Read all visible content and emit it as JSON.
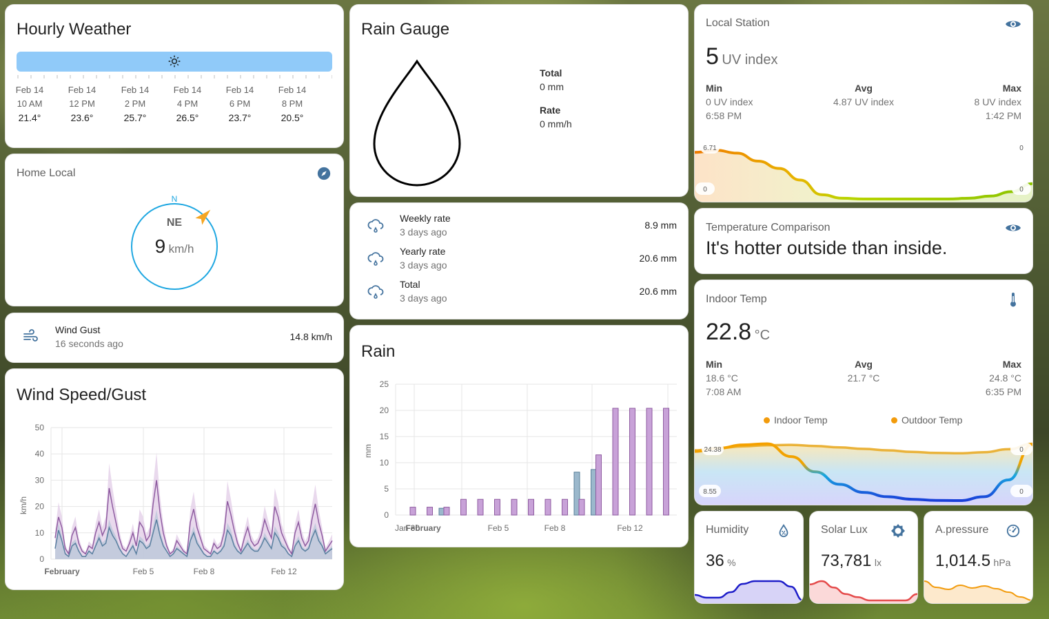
{
  "hourly_weather": {
    "title": "Hourly Weather",
    "forecast": [
      {
        "date": "Feb 14",
        "time": "10 AM",
        "temp": "21.4°"
      },
      {
        "date": "Feb 14",
        "time": "12 PM",
        "temp": "23.6°"
      },
      {
        "date": "Feb 14",
        "time": "2 PM",
        "temp": "25.7°"
      },
      {
        "date": "Feb 14",
        "time": "4 PM",
        "temp": "26.5°"
      },
      {
        "date": "Feb 14",
        "time": "6 PM",
        "temp": "23.7°"
      },
      {
        "date": "Feb 14",
        "time": "8 PM",
        "temp": "20.5°"
      }
    ],
    "bar_color": "#90caf9"
  },
  "home_local": {
    "title": "Home Local",
    "north": "N",
    "direction": "NE",
    "speed": "9",
    "unit": "km/h",
    "ring_color": "#1ea7e1",
    "arrow_color": "#f5a623"
  },
  "wind_gust": {
    "name": "Wind Gust",
    "ago": "16 seconds ago",
    "value": "14.8 km/h"
  },
  "wind_speed_gust": {
    "title": "Wind Speed/Gust",
    "ylabel": "km/h",
    "y_ticks": [
      "50",
      "40",
      "30",
      "20",
      "10",
      "0"
    ],
    "x_ticks": [
      "February",
      "Feb 5",
      "Feb 8",
      "Feb 12"
    ]
  },
  "rain_gauge": {
    "title": "Rain Gauge",
    "total_label": "Total",
    "total_value": "0 mm",
    "rate_label": "Rate",
    "rate_value": "0 mm/h"
  },
  "rain_rates": [
    {
      "name": "Weekly rate",
      "ago": "3 days ago",
      "value": "8.9 mm"
    },
    {
      "name": "Yearly rate",
      "ago": "3 days ago",
      "value": "20.6 mm"
    },
    {
      "name": "Total",
      "ago": "3 days ago",
      "value": "20.6 mm"
    }
  ],
  "rain_chart": {
    "title": "Rain",
    "ylabel": "mm",
    "y_ticks": [
      "25",
      "20",
      "15",
      "10",
      "5",
      "0"
    ],
    "x_ticks": [
      "Jan 30",
      "February",
      "Feb 5",
      "Feb 8",
      "Feb 12"
    ]
  },
  "chart_data": [
    {
      "type": "line",
      "title": "Wind Speed/Gust",
      "ylabel": "km/h",
      "ylim": [
        0,
        50
      ],
      "x_ticks": [
        "February",
        "Feb 5",
        "Feb 8",
        "Feb 12"
      ],
      "series": [
        {
          "values": [
            8,
            16,
            12,
            4,
            2,
            9,
            12,
            6,
            3,
            2,
            5,
            4,
            10,
            14,
            9,
            12,
            27,
            20,
            14,
            8,
            4,
            3,
            6,
            10,
            5,
            14,
            12,
            7,
            9,
            21,
            30,
            18,
            10,
            5,
            2,
            3,
            7,
            5,
            3,
            2,
            14,
            19,
            12,
            8,
            4,
            3,
            2,
            6,
            4,
            5,
            10,
            22,
            17,
            11,
            6,
            3,
            8,
            12,
            7,
            5,
            6,
            9,
            15,
            11,
            8,
            20,
            16,
            10,
            7,
            4,
            2,
            10,
            14,
            8,
            5,
            7,
            15,
            21,
            14,
            9,
            3,
            5,
            7
          ]
        },
        {
          "values": [
            4,
            11,
            7,
            2,
            1,
            5,
            6,
            3,
            1,
            1,
            3,
            2,
            5,
            8,
            5,
            6,
            12,
            9,
            7,
            4,
            2,
            1,
            3,
            5,
            2,
            7,
            6,
            4,
            5,
            10,
            15,
            9,
            5,
            3,
            1,
            2,
            4,
            3,
            2,
            1,
            7,
            10,
            6,
            4,
            2,
            1,
            1,
            3,
            2,
            3,
            5,
            11,
            9,
            5,
            3,
            2,
            4,
            6,
            4,
            3,
            3,
            5,
            8,
            6,
            4,
            10,
            8,
            5,
            4,
            2,
            1,
            5,
            7,
            4,
            3,
            4,
            8,
            11,
            7,
            5,
            2,
            3,
            4
          ]
        }
      ]
    },
    {
      "type": "bar",
      "title": "Rain",
      "ylabel": "mm",
      "ylim": [
        0,
        25
      ],
      "x_ticks": [
        "Jan 30",
        "February",
        "Feb 5",
        "Feb 8",
        "Feb 12"
      ],
      "series": [
        {
          "values": [
            1.5,
            1.5,
            1.5,
            3.0,
            3.0,
            3.0,
            3.0,
            3.0,
            3.0,
            3.0,
            3.0,
            11.5,
            20.4,
            20.4,
            20.4,
            20.4
          ]
        },
        {
          "values": [
            0,
            0,
            1.3,
            0,
            0,
            0,
            0,
            0,
            0,
            0,
            8.2,
            8.7,
            0,
            0,
            0,
            0
          ]
        }
      ]
    },
    {
      "type": "area",
      "title": "Local Station",
      "labels": [
        "6.71",
        "0",
        "0",
        "0"
      ],
      "series": [
        {
          "values": [
            6.4,
            6.71,
            6.3,
            5.2,
            4.2,
            2.6,
            0.6,
            0.1,
            0,
            0,
            0,
            0,
            0,
            0.1,
            0.4,
            1.0,
            2.1
          ]
        }
      ]
    },
    {
      "type": "line",
      "title": "Indoor Temp",
      "labels": [
        "24.38",
        "8.55",
        "0",
        "0"
      ],
      "series": [
        {
          "name": "Indoor Temp",
          "values": [
            22.3,
            22.9,
            23.4,
            23.7,
            23.8,
            23.5,
            23.1,
            22.7,
            22.3,
            21.9,
            21.6,
            21.5,
            21.8,
            22.6,
            24.1
          ]
        },
        {
          "name": "Outdoor Temp",
          "values": [
            22.0,
            22.9,
            23.8,
            24.1,
            20.6,
            16.4,
            13.0,
            10.8,
            9.6,
            8.9,
            8.6,
            8.55,
            9.6,
            14.2,
            23.9
          ]
        }
      ]
    },
    {
      "type": "area",
      "title": "Humidity",
      "series": [
        {
          "values": [
            34,
            33,
            33,
            35,
            38,
            39,
            39,
            39,
            37,
            32
          ]
        }
      ]
    },
    {
      "type": "area",
      "title": "Solar Lux",
      "series": [
        {
          "values": [
            50,
            60,
            40,
            20,
            10,
            0,
            0,
            0,
            0,
            20
          ]
        }
      ]
    },
    {
      "type": "area",
      "title": "A.pressure",
      "series": [
        {
          "values": [
            1015.8,
            1014.9,
            1014.6,
            1015.2,
            1014.8,
            1015.1,
            1014.7,
            1014.2,
            1013.5,
            1013.0
          ]
        }
      ]
    }
  ],
  "local_station": {
    "title": "Local Station",
    "value": "5",
    "unit": "UV index",
    "min_label": "Min",
    "min_value": "0 UV index",
    "min_time": "6:58 PM",
    "avg_label": "Avg",
    "avg_value": "4.87 UV index",
    "max_label": "Max",
    "max_value": "8 UV index",
    "max_time": "1:42 PM"
  },
  "temperature_comparison": {
    "title": "Temperature Comparison",
    "text": "It's hotter outside than inside."
  },
  "indoor_temp": {
    "title": "Indoor Temp",
    "value": "22.8",
    "unit": "°C",
    "min_label": "Min",
    "min_value": "18.6 °C",
    "min_time": "7:08 AM",
    "avg_label": "Avg",
    "avg_value": "21.7 °C",
    "max_label": "Max",
    "max_value": "24.8 °C",
    "max_time": "6:35 PM",
    "legend": [
      "Indoor Temp",
      "Outdoor Temp"
    ],
    "legend_color": "#f29b0c"
  },
  "humidity": {
    "title": "Humidity",
    "value": "36",
    "unit": "%"
  },
  "solar_lux": {
    "title": "Solar Lux",
    "value": "73,781",
    "unit": "lx"
  },
  "pressure": {
    "title": "A.pressure",
    "value": "1,014.5",
    "unit": "hPa"
  },
  "colors": {
    "icon": "#44739e",
    "rain_bar_purple": "#c8a2d8",
    "rain_bar_blue": "#9bb8cc",
    "wind_gust": "#8e5ba0",
    "wind_speed": "#5a7fa0"
  }
}
